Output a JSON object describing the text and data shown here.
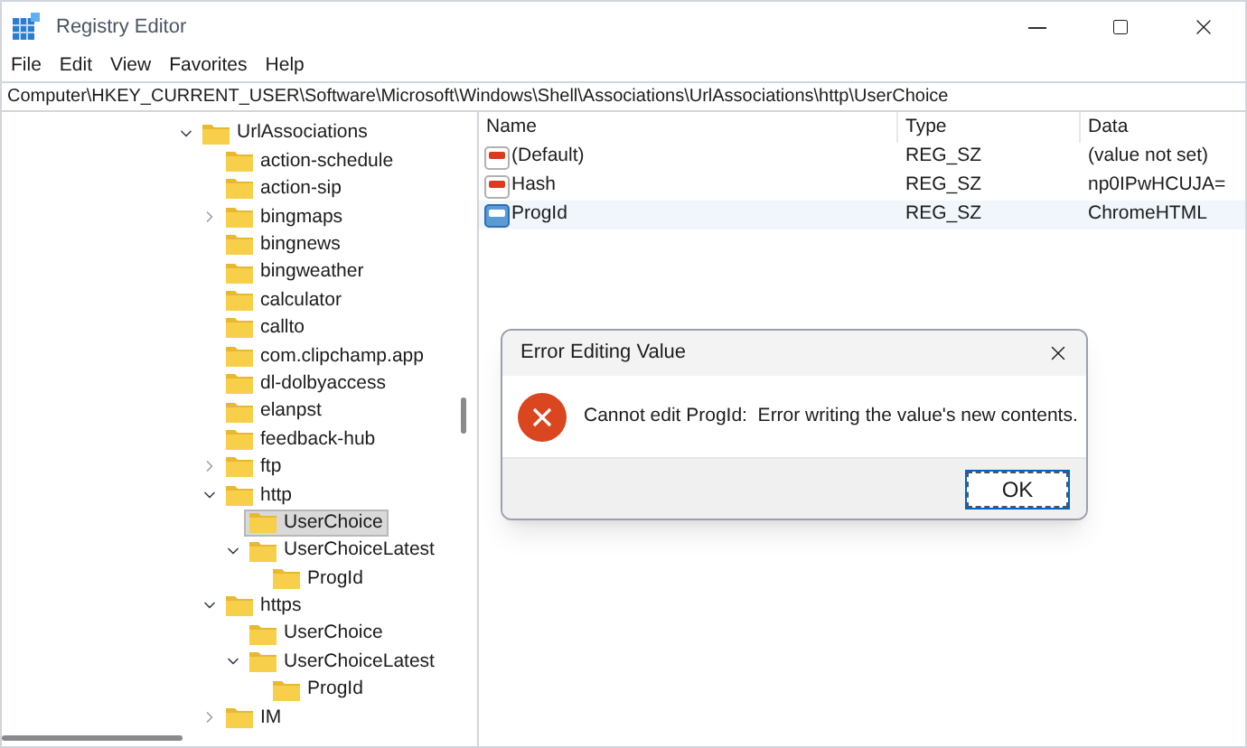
{
  "window": {
    "title": "Registry Editor"
  },
  "menu": [
    "File",
    "Edit",
    "View",
    "Favorites",
    "Help"
  ],
  "address": "Computer\\HKEY_CURRENT_USER\\Software\\Microsoft\\Windows\\Shell\\Associations\\UrlAssociations\\http\\UserChoice",
  "tree": [
    {
      "label": "UrlAssociations",
      "expanded": true,
      "selected": false,
      "children": [
        {
          "label": "action-schedule",
          "selected": false
        },
        {
          "label": "action-sip",
          "selected": false
        },
        {
          "label": "bingmaps",
          "expanded": false,
          "selected": false
        },
        {
          "label": "bingnews",
          "selected": false
        },
        {
          "label": "bingweather",
          "selected": false
        },
        {
          "label": "calculator",
          "selected": false
        },
        {
          "label": "callto",
          "selected": false
        },
        {
          "label": "com.clipchamp.app",
          "selected": false
        },
        {
          "label": "dl-dolbyaccess",
          "selected": false
        },
        {
          "label": "elanpst",
          "selected": false
        },
        {
          "label": "feedback-hub",
          "selected": false
        },
        {
          "label": "ftp",
          "expanded": false,
          "selected": false
        },
        {
          "label": "http",
          "expanded": true,
          "selected": false,
          "children": [
            {
              "label": "UserChoice",
              "selected": true
            },
            {
              "label": "UserChoiceLatest",
              "expanded": true,
              "selected": false,
              "children": [
                {
                  "label": "ProgId",
                  "selected": false
                }
              ]
            }
          ]
        },
        {
          "label": "https",
          "expanded": true,
          "selected": false,
          "children": [
            {
              "label": "UserChoice",
              "selected": false
            },
            {
              "label": "UserChoiceLatest",
              "expanded": true,
              "selected": false,
              "children": [
                {
                  "label": "ProgId",
                  "selected": false
                }
              ]
            }
          ]
        },
        {
          "label": "IM",
          "expanded": false,
          "selected": false
        }
      ]
    }
  ],
  "values": {
    "columns": [
      "Name",
      "Type",
      "Data"
    ],
    "rows": [
      {
        "name": "(Default)",
        "type": "REG_SZ",
        "data": "(value not set)",
        "selected": false
      },
      {
        "name": "Hash",
        "type": "REG_SZ",
        "data": "np0IPwHCUJA=",
        "selected": false
      },
      {
        "name": "ProgId",
        "type": "REG_SZ",
        "data": "ChromeHTML",
        "selected": true
      }
    ]
  },
  "dialog": {
    "title": "Error Editing Value",
    "message": "Cannot edit ProgId:  Error writing the value's new contents.",
    "button": "OK"
  }
}
